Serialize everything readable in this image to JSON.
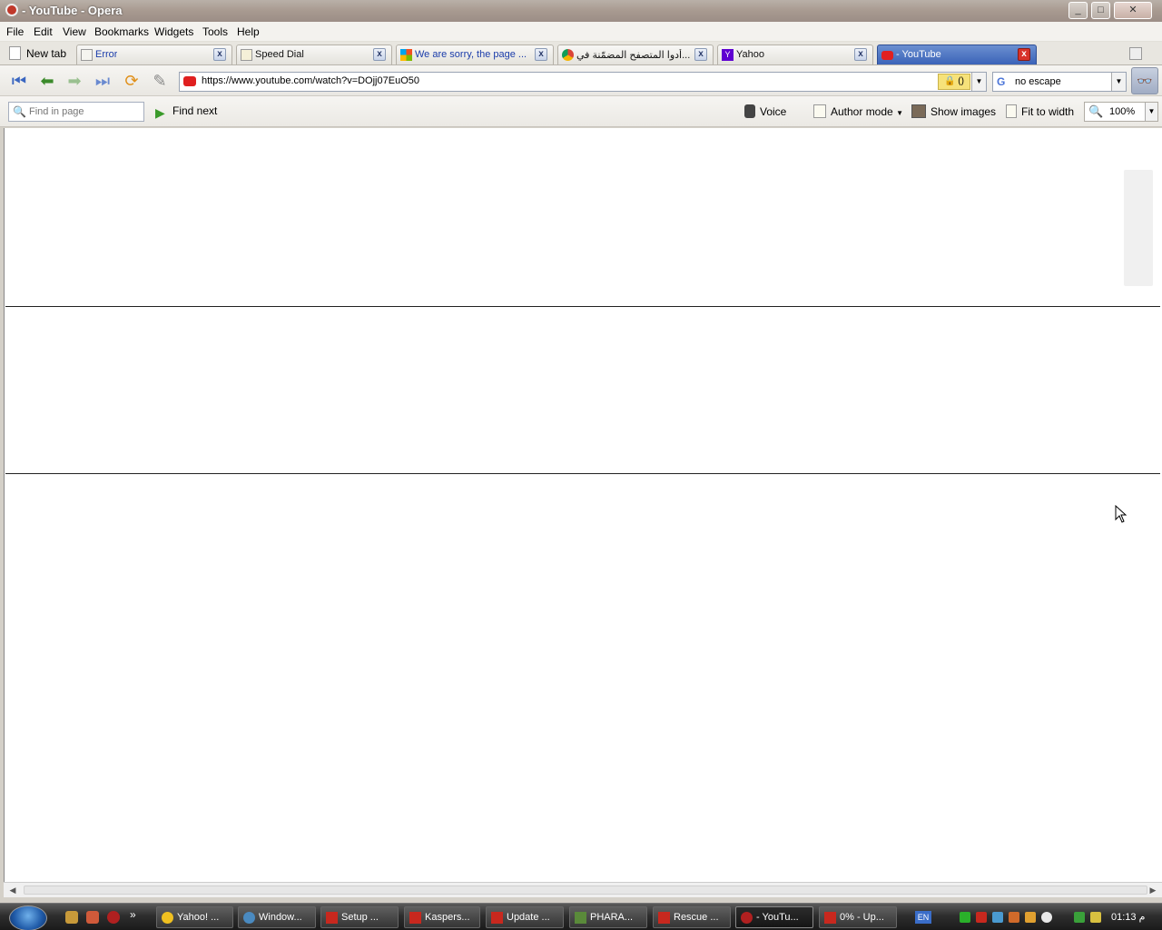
{
  "window": {
    "title": "- YouTube - Opera"
  },
  "menu": [
    "File",
    "Edit",
    "View",
    "Bookmarks",
    "Widgets",
    "Tools",
    "Help"
  ],
  "tabs": {
    "new_tab_label": "New tab",
    "items": [
      {
        "label": "Error",
        "icon": "page-icon",
        "active": false
      },
      {
        "label": "Speed Dial",
        "icon": "page-icon",
        "active": false
      },
      {
        "label": "We are sorry, the page ...",
        "icon": "windows-icon",
        "active": false
      },
      {
        "label": "أدوا المتصفح المضمّنة في...",
        "icon": "google-chrome-icon",
        "active": false
      },
      {
        "label": "Yahoo",
        "icon": "yahoo-icon",
        "active": false
      },
      {
        "label": "- YouTube",
        "icon": "youtube-icon",
        "active": true
      }
    ]
  },
  "navbar": {
    "url": "https://www.youtube.com/watch?v=DOjj07EuO50",
    "security_badge": "()",
    "search_value": "no escape",
    "search_engine_icon": "google-icon"
  },
  "findbar": {
    "find_placeholder": "Find in page",
    "find_next": "Find next",
    "voice": "Voice",
    "author_mode": "Author mode",
    "show_images": "Show images",
    "fit_to_width": "Fit to width",
    "zoom": "100%"
  },
  "taskbar": {
    "buttons": [
      "Yahoo! ...",
      "Window...",
      "Setup ...",
      "Kaspers...",
      "Update ...",
      "PHARA...",
      "Rescue ...",
      "- YouTu...",
      "0% - Up..."
    ],
    "language": "EN",
    "clock": "01:13 م"
  },
  "colors": {
    "active_tab": "#3a63b8",
    "youtube_red": "#e02020",
    "taskbar": "#2e2e2e"
  }
}
